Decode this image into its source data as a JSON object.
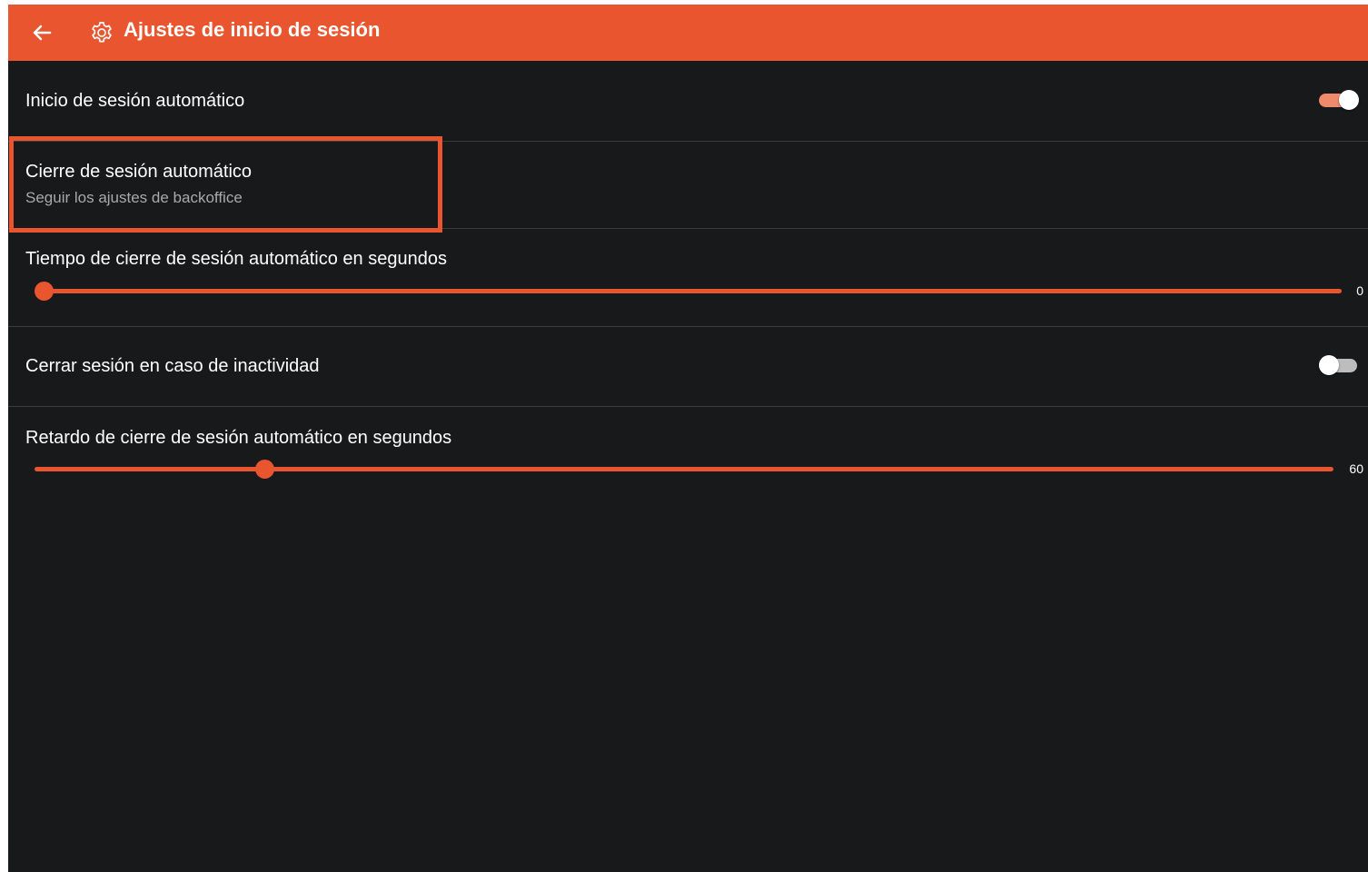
{
  "header": {
    "back_icon": "arrow-left-icon",
    "settings_icon": "gear-icon",
    "title": "Ajustes de inicio de sesión"
  },
  "settings": {
    "auto_login": {
      "label": "Inicio de sesión automático",
      "enabled": true
    },
    "auto_logout": {
      "label": "Cierre de sesión automático",
      "subtitle": "Seguir los ajustes de backoffice"
    },
    "auto_logout_time": {
      "label": "Tiempo de cierre de sesión automático en segundos",
      "value": "0",
      "fraction": 0.0
    },
    "logout_on_inactivity": {
      "label": "Cerrar sesión en caso de inactividad",
      "enabled": false
    },
    "auto_logout_delay": {
      "label": "Retardo de cierre de sesión automático en segundos",
      "value": "60",
      "fraction": 0.177
    }
  },
  "colors": {
    "accent": "#e8552f",
    "background": "#18191b",
    "divider": "#3a3b3d",
    "switch_on_track": "#f08a6c",
    "switch_off_track": "#bdbdbd"
  }
}
